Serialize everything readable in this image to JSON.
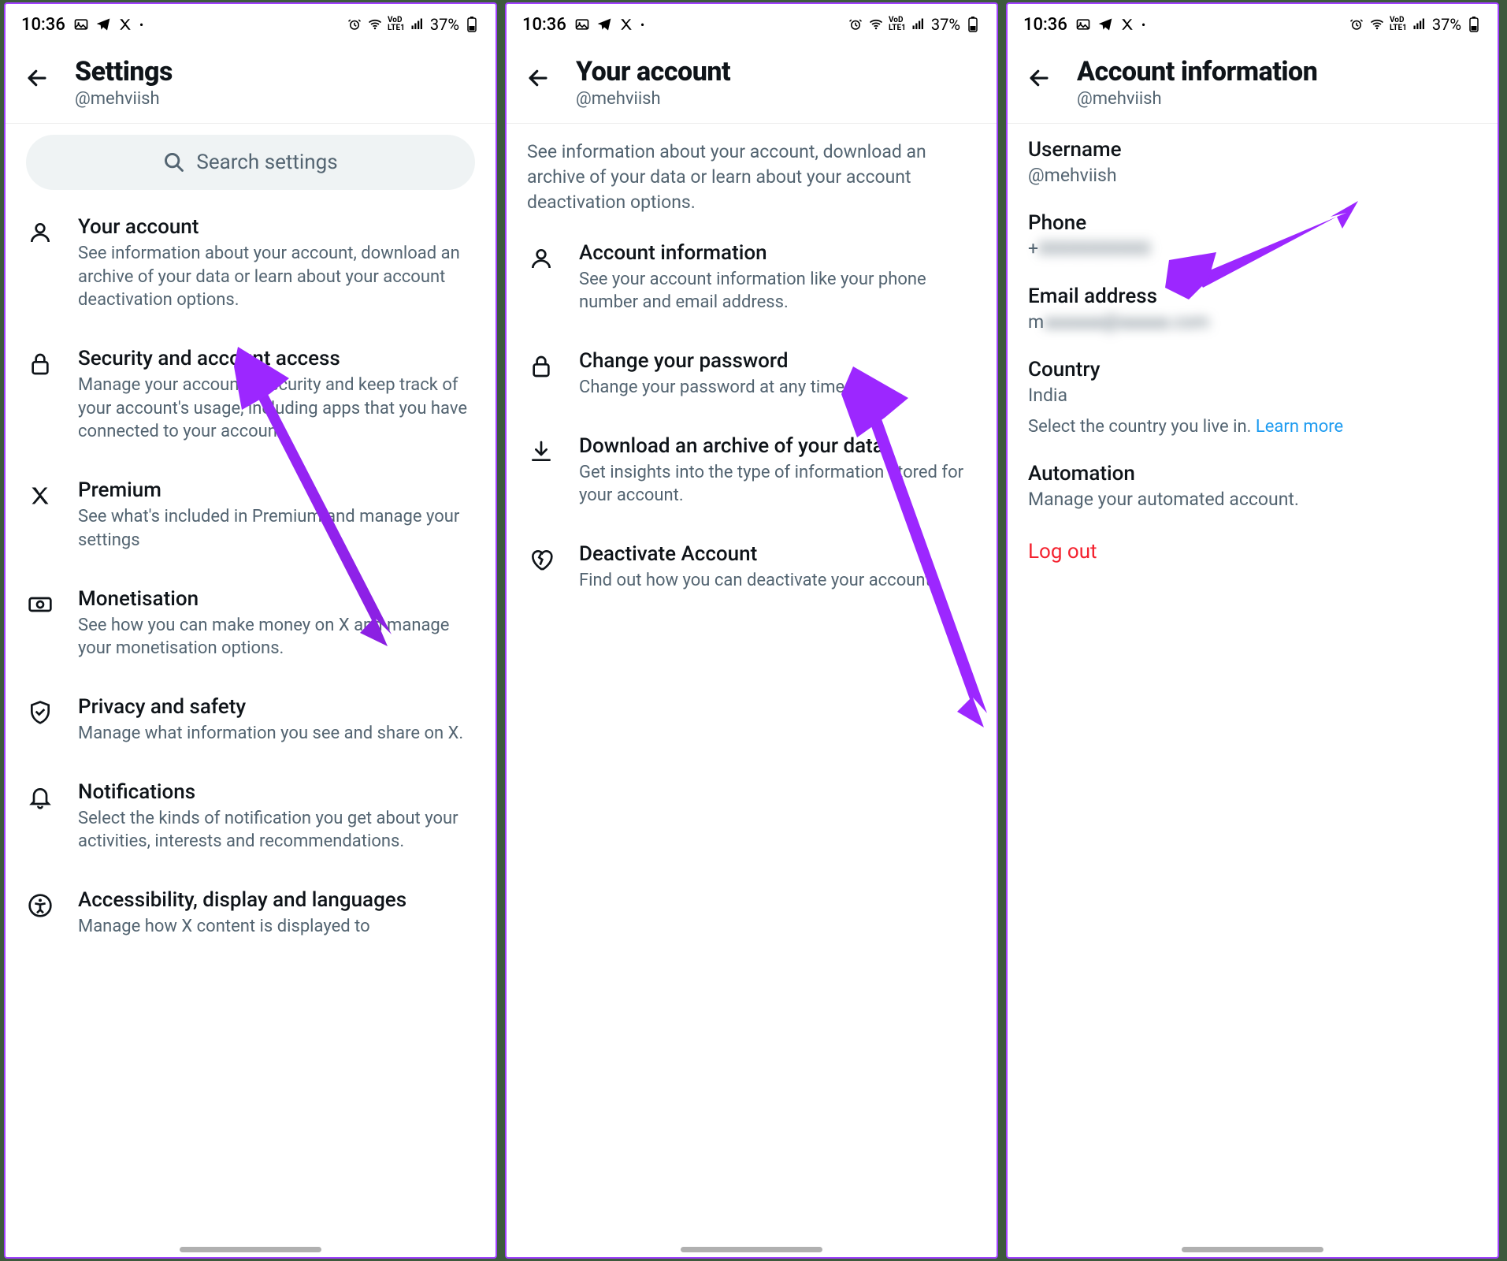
{
  "status": {
    "time": "10:36",
    "battery": "37%"
  },
  "screen1": {
    "title": "Settings",
    "handle": "@mehviish",
    "search_placeholder": "Search settings",
    "items": [
      {
        "title": "Your account",
        "desc": "See information about your account, download an archive of your data or learn about your account deactivation options."
      },
      {
        "title": "Security and account access",
        "desc": "Manage your account's security and keep track of your account's usage, including apps that you have connected to your account."
      },
      {
        "title": "Premium",
        "desc": "See what's included in Premium and manage your settings"
      },
      {
        "title": "Monetisation",
        "desc": "See how you can make money on X and manage your monetisation options."
      },
      {
        "title": "Privacy and safety",
        "desc": "Manage what information you see and share on X."
      },
      {
        "title": "Notifications",
        "desc": "Select the kinds of notification you get about your activities, interests and recommendations."
      },
      {
        "title": "Accessibility, display and languages",
        "desc": "Manage how X content is displayed to"
      }
    ]
  },
  "screen2": {
    "title": "Your account",
    "handle": "@mehviish",
    "desc": "See information about your account, download an archive of your data or learn about your account deactivation options.",
    "items": [
      {
        "title": "Account information",
        "desc": "See your account information like your phone number and email address."
      },
      {
        "title": "Change your password",
        "desc": "Change your password at any time."
      },
      {
        "title": "Download an archive of your data",
        "desc": "Get insights into the type of information stored for your account."
      },
      {
        "title": "Deactivate Account",
        "desc": "Find out how you can deactivate your account."
      }
    ]
  },
  "screen3": {
    "title": "Account information",
    "handle": "@mehviish",
    "username_label": "Username",
    "username_value": "@mehviish",
    "phone_label": "Phone",
    "phone_value": "+ ████████",
    "email_label": "Email address",
    "email_value": "m███████████",
    "country_label": "Country",
    "country_value": "India",
    "country_extra": "Select the country you live in. ",
    "learn_more": "Learn more",
    "automation_label": "Automation",
    "automation_value": "Manage your automated account.",
    "logout": "Log out"
  }
}
